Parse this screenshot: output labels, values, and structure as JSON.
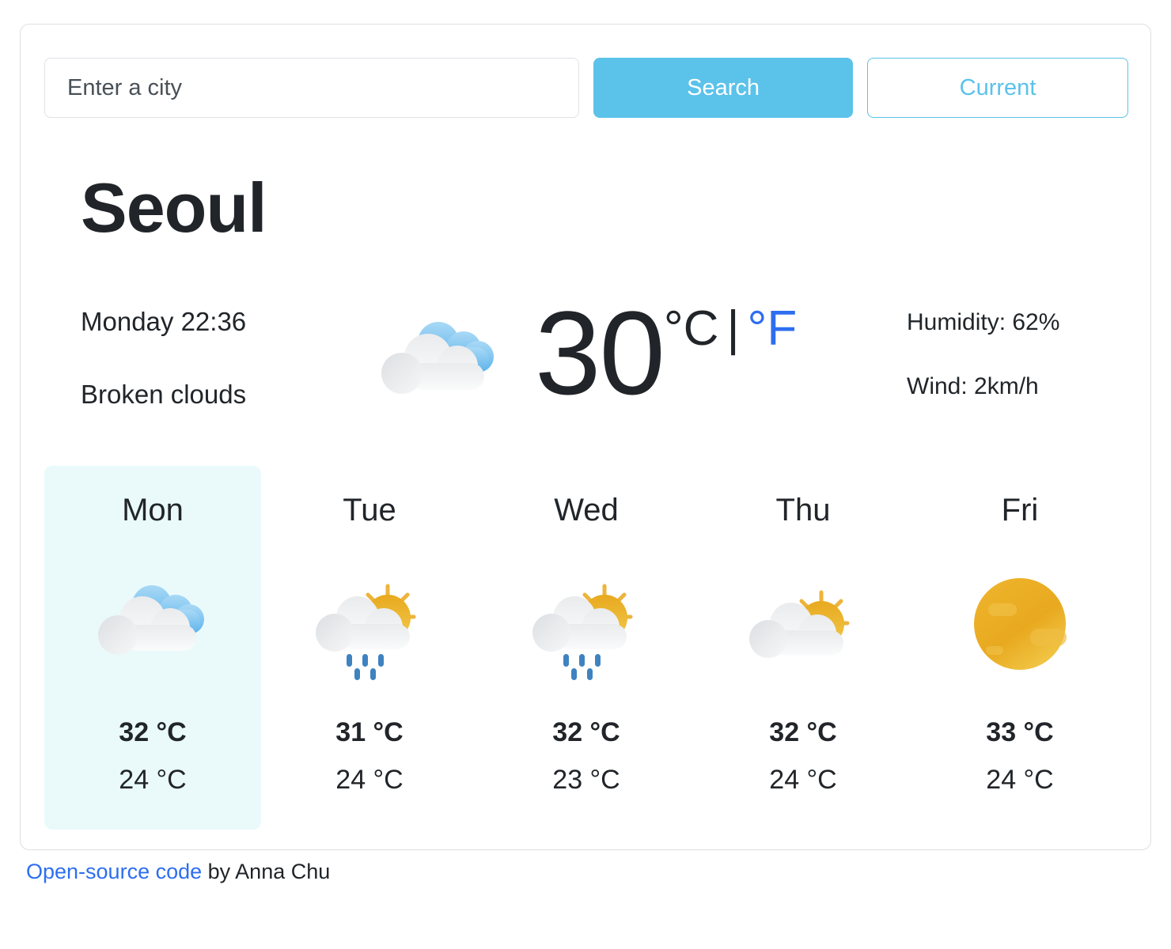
{
  "search": {
    "placeholder": "Enter a city",
    "value": "",
    "search_label": "Search",
    "current_label": "Current"
  },
  "city": "Seoul",
  "current": {
    "datetime": "Monday 22:36",
    "description": "Broken clouds",
    "icon": "broken-clouds-icon",
    "temperature": "30",
    "unit_celsius": "°C",
    "unit_separator": "|",
    "unit_fahrenheit": "°F",
    "humidity": "Humidity: 62%",
    "wind": "Wind: 2km/h"
  },
  "forecast": [
    {
      "day": "Mon",
      "icon": "broken-clouds-icon",
      "max": "32 °C",
      "min": "24 °C",
      "active": true
    },
    {
      "day": "Tue",
      "icon": "sun-cloud-rain-icon",
      "max": "31 °C",
      "min": "24 °C",
      "active": false
    },
    {
      "day": "Wed",
      "icon": "sun-cloud-rain-icon",
      "max": "32 °C",
      "min": "23 °C",
      "active": false
    },
    {
      "day": "Thu",
      "icon": "sun-cloud-icon",
      "max": "32 °C",
      "min": "24 °C",
      "active": false
    },
    {
      "day": "Fri",
      "icon": "sun-icon",
      "max": "33 °C",
      "min": "24 °C",
      "active": false
    }
  ],
  "footer": {
    "link_text": "Open-source code",
    "credit": " by Anna Chu"
  },
  "colors": {
    "accent": "#5bc2ea",
    "link": "#2d6ef0",
    "active_card": "#eafafb",
    "text": "#212529",
    "sun": "#e8ab26",
    "rain": "#3f82c0",
    "cloud_blue": "#8ec9f0"
  }
}
